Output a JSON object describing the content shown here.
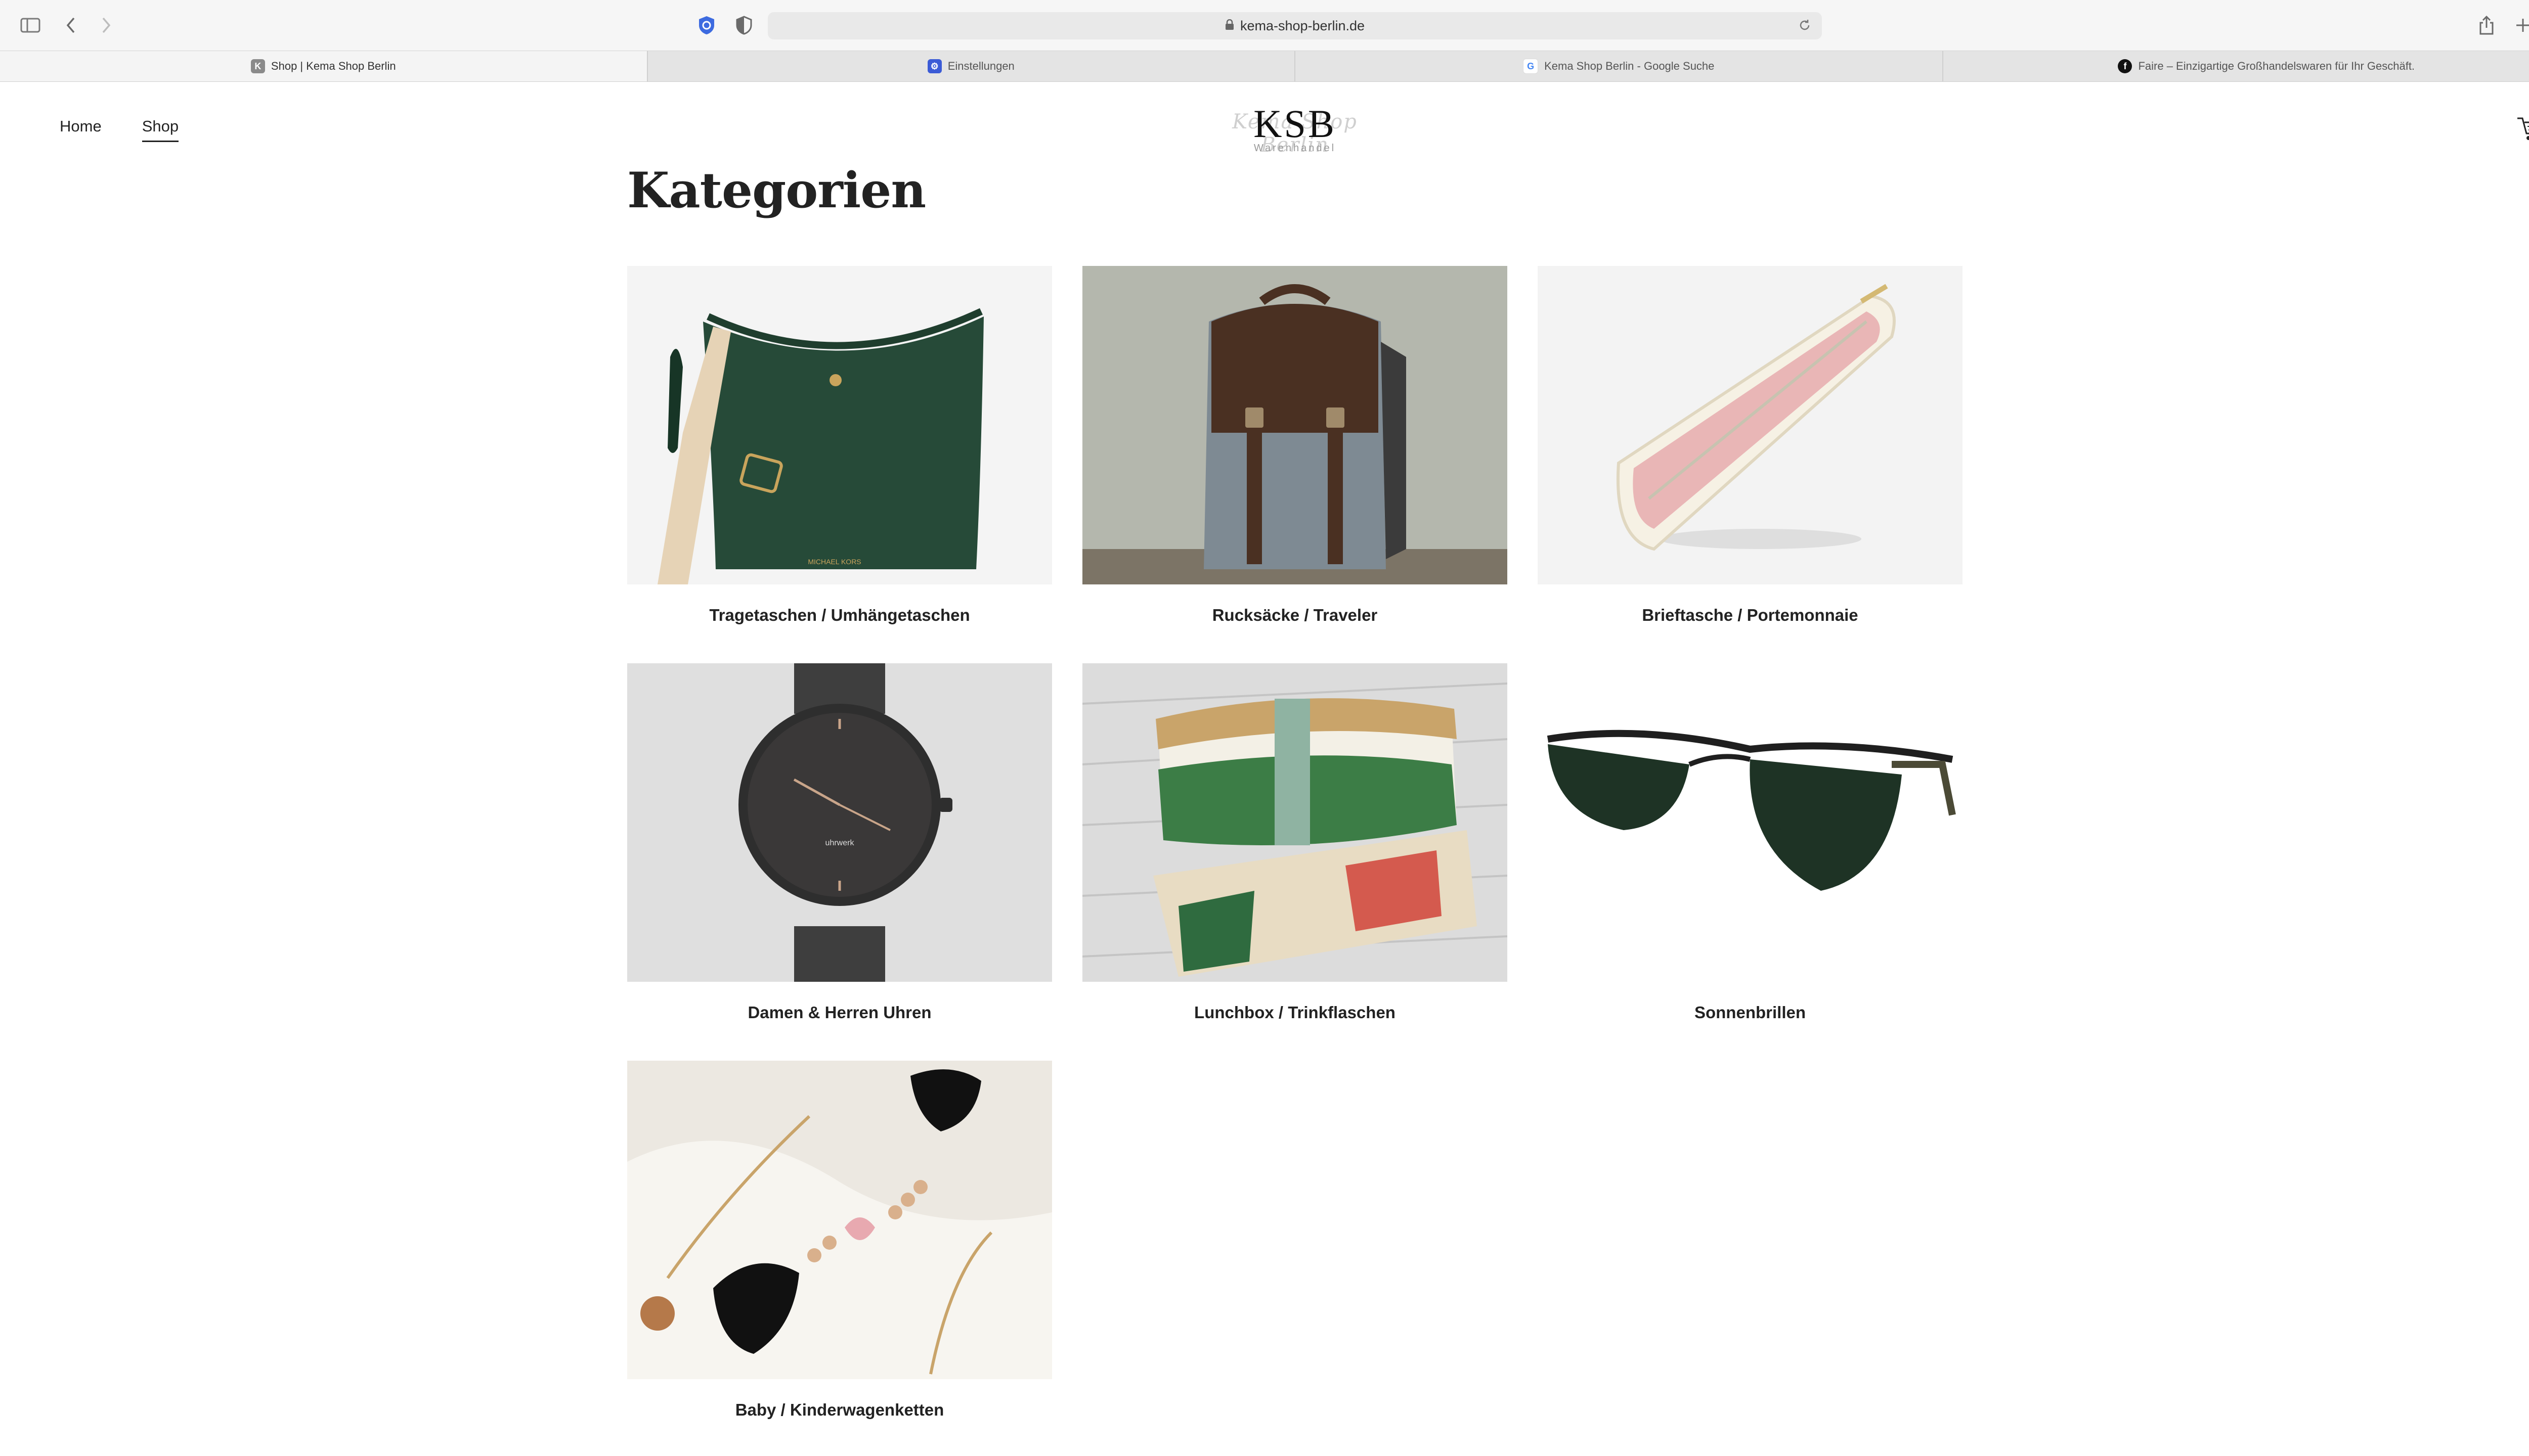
{
  "browser": {
    "url": "kema-shop-berlin.de",
    "tabs": [
      {
        "title": "Shop | Kema Shop Berlin",
        "icon": "k-favicon-icon",
        "color": "#8a8a8a"
      },
      {
        "title": "Einstellungen",
        "icon": "settings-favicon-icon",
        "color": "#3b5bd6"
      },
      {
        "title": "Kema Shop Berlin - Google Suche",
        "icon": "google-favicon-icon",
        "color": "#4285f4"
      },
      {
        "title": "Faire – Einzigartige Großhandelswaren für Ihr Geschäft.",
        "icon": "faire-favicon-icon",
        "color": "#111111"
      }
    ]
  },
  "site": {
    "nav": [
      {
        "label": "Home",
        "active": false
      },
      {
        "label": "Shop",
        "active": true
      }
    ],
    "logo": {
      "initials": "KSB",
      "script": "Kema Shop Berlin",
      "sub": "Warenhandel"
    }
  },
  "page": {
    "title": "Kategorien",
    "categories": [
      {
        "label": "Tragetaschen / Umhängetaschen"
      },
      {
        "label": "Rucksäcke / Traveler"
      },
      {
        "label": "Brieftasche / Portemonnaie"
      },
      {
        "label": "Damen & Herren Uhren"
      },
      {
        "label": "Lunchbox / Trinkflaschen"
      },
      {
        "label": "Sonnenbrillen"
      },
      {
        "label": "Baby / Kinderwagenketten"
      }
    ]
  }
}
